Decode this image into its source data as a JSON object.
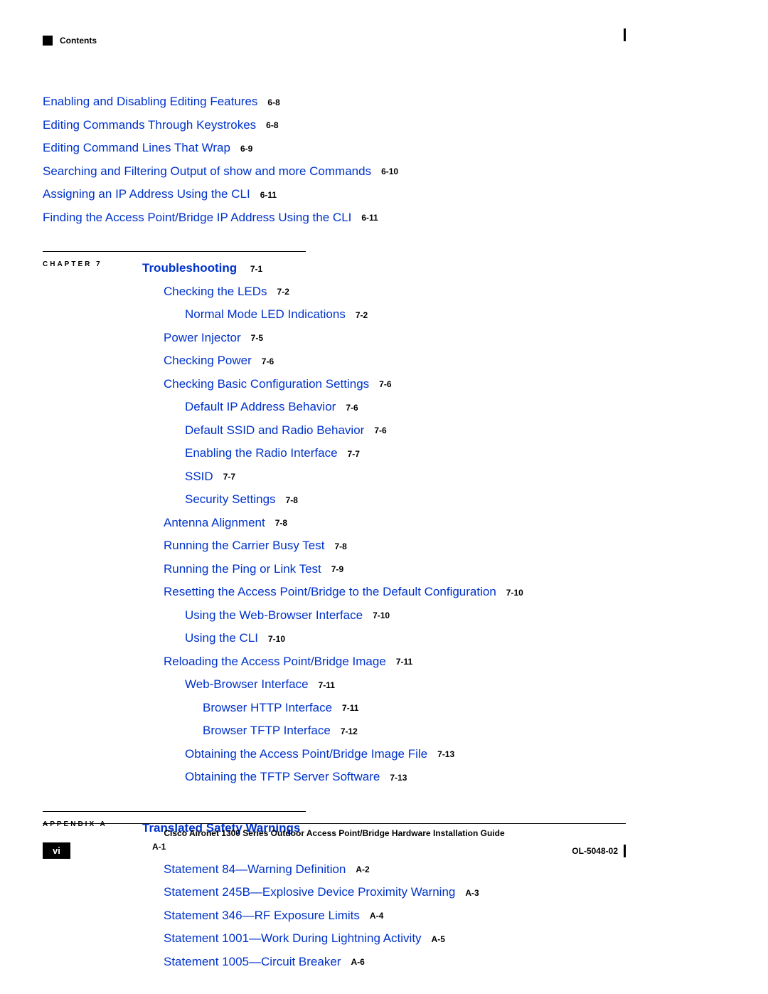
{
  "header": {
    "label": "Contents"
  },
  "block1": [
    {
      "indent": "ind1",
      "text": "Enabling and Disabling Editing Features",
      "ref": "6-8"
    },
    {
      "indent": "ind1",
      "text": "Editing Commands Through Keystrokes",
      "ref": "6-8"
    },
    {
      "indent": "ind1",
      "text": "Editing Command Lines That Wrap",
      "ref": "6-9"
    },
    {
      "indent": "ind0",
      "text": "Searching and Filtering Output of show and more Commands",
      "ref": "6-10"
    },
    {
      "indent": "ind0",
      "text": "Assigning an IP Address Using the CLI",
      "ref": "6-11"
    },
    {
      "indent": "ind0",
      "text": "Finding the Access Point/Bridge IP Address Using the CLI",
      "ref": "6-11"
    }
  ],
  "chapter7": {
    "label": "CHAPTER 7",
    "title": "Troubleshooting",
    "titleRef": "7-1",
    "items": [
      {
        "indent": "ind0",
        "text": "Checking the LEDs",
        "ref": "7-2"
      },
      {
        "indent": "ind1",
        "text": "Normal Mode LED Indications",
        "ref": "7-2"
      },
      {
        "indent": "ind0",
        "text": "Power Injector",
        "ref": "7-5"
      },
      {
        "indent": "ind0",
        "text": "Checking Power",
        "ref": "7-6"
      },
      {
        "indent": "ind0",
        "text": "Checking Basic Configuration Settings",
        "ref": "7-6"
      },
      {
        "indent": "ind1",
        "text": "Default IP Address Behavior",
        "ref": "7-6"
      },
      {
        "indent": "ind1",
        "text": "Default SSID and Radio Behavior",
        "ref": "7-6"
      },
      {
        "indent": "ind1",
        "text": "Enabling the Radio Interface",
        "ref": "7-7"
      },
      {
        "indent": "ind1",
        "text": "SSID",
        "ref": "7-7"
      },
      {
        "indent": "ind1",
        "text": "Security Settings",
        "ref": "7-8"
      },
      {
        "indent": "ind0",
        "text": "Antenna Alignment",
        "ref": "7-8"
      },
      {
        "indent": "ind0",
        "text": "Running the Carrier Busy Test",
        "ref": "7-8"
      },
      {
        "indent": "ind0",
        "text": "Running the Ping or Link Test",
        "ref": "7-9"
      },
      {
        "indent": "ind0",
        "text": "Resetting the Access Point/Bridge to the Default Configuration",
        "ref": "7-10"
      },
      {
        "indent": "ind1",
        "text": "Using the Web-Browser Interface",
        "ref": "7-10"
      },
      {
        "indent": "ind1",
        "text": "Using the CLI",
        "ref": "7-10"
      },
      {
        "indent": "ind0",
        "text": "Reloading the Access Point/Bridge Image",
        "ref": "7-11"
      },
      {
        "indent": "ind1",
        "text": "Web-Browser Interface",
        "ref": "7-11"
      },
      {
        "indent": "ind2",
        "text": "Browser HTTP Interface",
        "ref": "7-11"
      },
      {
        "indent": "ind2",
        "text": "Browser TFTP Interface",
        "ref": "7-12"
      },
      {
        "indent": "ind1",
        "text": "Obtaining the Access Point/Bridge Image File",
        "ref": "7-13"
      },
      {
        "indent": "ind1",
        "text": "Obtaining the TFTP Server Software",
        "ref": "7-13"
      }
    ]
  },
  "appendixA": {
    "label": "APPENDIX A",
    "title": "Translated Safety Warnings",
    "titleRef": "A-1",
    "items": [
      {
        "indent": "ind0",
        "text": "Statement 84—Warning Definition",
        "ref": "A-2"
      },
      {
        "indent": "ind0",
        "text": "Statement 245B—Explosive Device Proximity Warning",
        "ref": "A-3"
      },
      {
        "indent": "ind0",
        "text": "Statement 346—RF Exposure Limits",
        "ref": "A-4"
      },
      {
        "indent": "ind0",
        "text": "Statement 1001—Work During Lightning Activity",
        "ref": "A-5"
      },
      {
        "indent": "ind0",
        "text": "Statement 1005—Circuit Breaker",
        "ref": "A-6"
      }
    ]
  },
  "footer": {
    "title": "Cisco Aironet 1300 Series Outdoor Access Point/Bridge Hardware Installation Guide",
    "pageNum": "vi",
    "docId": "OL-5048-02"
  }
}
